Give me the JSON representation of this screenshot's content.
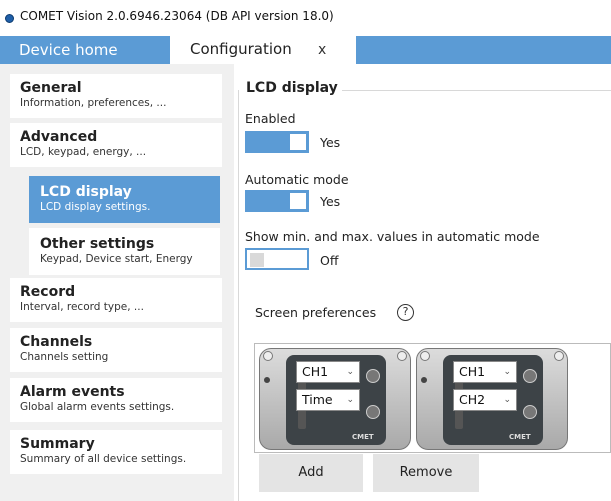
{
  "window": {
    "title": "COMET Vision 2.0.6946.23064 (DB API version 18.0)"
  },
  "tabs": {
    "home_label": "Device home",
    "config_label": "Configuration",
    "close_label": "x"
  },
  "nav": {
    "items": [
      {
        "title": "General",
        "subtitle": "Information, preferences, ..."
      },
      {
        "title": "Advanced",
        "subtitle": "LCD, keypad, energy, ..."
      },
      {
        "title": "LCD display",
        "subtitle": "LCD display settings."
      },
      {
        "title": "Other settings",
        "subtitle": "Keypad, Device start, Energy"
      },
      {
        "title": "Record",
        "subtitle": "Interval, record type, ..."
      },
      {
        "title": "Channels",
        "subtitle": "Channels setting"
      },
      {
        "title": "Alarm events",
        "subtitle": "Global alarm events settings."
      },
      {
        "title": "Summary",
        "subtitle": "Summary of all device settings."
      }
    ]
  },
  "lcd": {
    "section_title": "LCD display",
    "enabled_label": "Enabled",
    "enabled_value": "Yes",
    "automatic_label": "Automatic mode",
    "automatic_value": "Yes",
    "minmax_label": "Show min. and max. values in automatic mode",
    "minmax_value": "Off",
    "screen_pref_label": "Screen preferences",
    "help_symbol": "?"
  },
  "screens": [
    {
      "row1": "CH1",
      "row2": "Time"
    },
    {
      "row1": "CH1",
      "row2": "CH2"
    }
  ],
  "buttons": {
    "add": "Add",
    "remove": "Remove"
  },
  "colors": {
    "accent": "#5b9bd5"
  }
}
